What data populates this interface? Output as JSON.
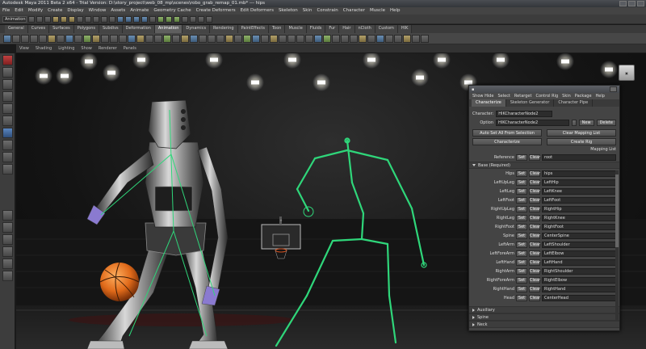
{
  "window": {
    "title": "Autodesk Maya 2011 Beta 2 x64 - Trial Version: D:\\story_project\\web_08_mp\\scenes\\robo_grab_remap_01.mb* --- hips"
  },
  "menubar": {
    "items": [
      "File",
      "Edit",
      "Modify",
      "Create",
      "Display",
      "Window",
      "Assets",
      "Animate",
      "Geometry Cache",
      "Create Deformers",
      "Edit Deformers",
      "Skeleton",
      "Skin",
      "Constrain",
      "Character",
      "Muscle",
      "Help"
    ]
  },
  "statusline": {
    "mode": "Animation"
  },
  "shelf": {
    "tabs": [
      "General",
      "Curves",
      "Surfaces",
      "Polygons",
      "Subdivs",
      "Deformation",
      "Animation",
      "Dynamics",
      "Rendering",
      "PaintEffects",
      "Toon",
      "Muscle",
      "Fluids",
      "Fur",
      "Hair",
      "nCloth",
      "Custom",
      "HIK"
    ],
    "active_tab": "Animation"
  },
  "viewport": {
    "menu": [
      "View",
      "Shading",
      "Lighting",
      "Show",
      "Renderer",
      "Panels"
    ]
  },
  "hik_panel": {
    "menu": [
      "Show Hide",
      "Select",
      "Retarget",
      "Control Rig",
      "Skin",
      "Package",
      "Help"
    ],
    "tabs": [
      "Characterize",
      "Skeleton Generator",
      "Character Pipe"
    ],
    "active_tab": "Characterize",
    "character_label": "Character:",
    "character_value": "HIKCharacterNode2",
    "option_label": "Option",
    "option_value": "HIKCharacterNode2",
    "buttons": {
      "new": "New",
      "delete": "Delete",
      "auto_t_stance": "Auto Set All From Selection",
      "clear_mapping": "Clear Mapping List",
      "characterize": "Characterize",
      "create_rig": "Create Rig"
    },
    "mapping_list_title": "Mapping List",
    "reference": {
      "label": "Reference",
      "set": "Set",
      "clear": "Clear",
      "value": "root"
    },
    "sections": {
      "base": "Base (Required)",
      "auxiliary": "Auxiliary",
      "spine": "Spine",
      "neck": "Neck"
    },
    "set_label": "Set",
    "clear_label": "Clear",
    "joints": [
      {
        "name": "Hips",
        "value": "hips"
      },
      {
        "name": "LeftUpLeg",
        "value": "LeftHip"
      },
      {
        "name": "LeftLeg",
        "value": "LeftKnee"
      },
      {
        "name": "LeftFoot",
        "value": "LeftFoot"
      },
      {
        "name": "RightUpLeg",
        "value": "RightHip"
      },
      {
        "name": "RightLeg",
        "value": "RightKnee"
      },
      {
        "name": "RightFoot",
        "value": "RightFoot"
      },
      {
        "name": "Spine",
        "value": "CenterSpine"
      },
      {
        "name": "LeftArm",
        "value": "LeftShoulder"
      },
      {
        "name": "LeftForeArm",
        "value": "LeftElbow"
      },
      {
        "name": "LeftHand",
        "value": "LeftHand"
      },
      {
        "name": "RightArm",
        "value": "RightShoulder"
      },
      {
        "name": "RightForeArm",
        "value": "RightElbow"
      },
      {
        "name": "RightHand",
        "value": "RightHand"
      },
      {
        "name": "Head",
        "value": "CenterHead"
      }
    ]
  },
  "colors": {
    "skeleton": "#2fd67a",
    "panel_bg": "#444444",
    "accent_red": "#c04040"
  }
}
